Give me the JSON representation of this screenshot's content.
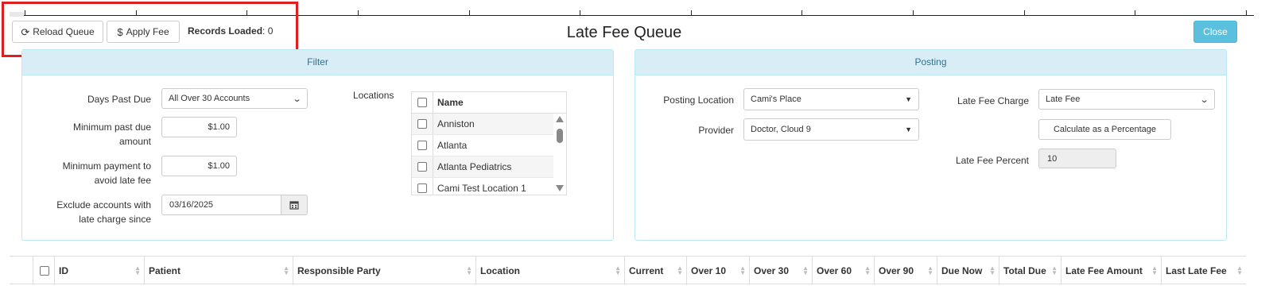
{
  "toolbar": {
    "reload_label": "Reload Queue",
    "apply_label": "Apply Fee",
    "records_label": "Records Loaded",
    "records_value": ": 0",
    "close_label": "Close",
    "reload_icon": "refresh-icon",
    "apply_icon": "dollar-icon"
  },
  "page_title": "Late Fee Queue",
  "filter": {
    "title": "Filter",
    "days_past_due_label": "Days Past Due",
    "days_past_due_value": "All Over 30 Accounts",
    "min_past_due_label_1": "Minimum past due",
    "min_past_due_label_2": "amount",
    "min_past_due_value": "$1.00",
    "min_payment_label_1": "Minimum payment to",
    "min_payment_label_2": "avoid late fee",
    "min_payment_value": "$1.00",
    "exclude_label_1": "Exclude accounts with",
    "exclude_label_2": "late charge since",
    "exclude_date": "03/16/2025",
    "locations_label": "Locations",
    "locations_header": "Name",
    "locations": [
      "Anniston",
      "Atlanta",
      "Atlanta Pediatrics",
      "Cami Test Location 1"
    ]
  },
  "posting": {
    "title": "Posting",
    "posting_location_label": "Posting Location",
    "posting_location_value": "Cami's Place",
    "provider_label": "Provider",
    "provider_value": "Doctor, Cloud 9",
    "late_fee_charge_label": "Late Fee Charge",
    "late_fee_charge_value": "Late Fee",
    "calc_percentage_label": "Calculate as a Percentage",
    "late_fee_percent_label": "Late Fee Percent",
    "late_fee_percent_value": "10"
  },
  "grid": {
    "columns": [
      "ID",
      "Patient",
      "Responsible Party",
      "Location",
      "Current",
      "Over 10",
      "Over 30",
      "Over 60",
      "Over 90",
      "Due Now",
      "Total Due",
      "Late Fee Amount",
      "Last Late Fee"
    ]
  },
  "colors": {
    "panel_header_bg": "#d9edf7",
    "panel_header_text": "#31708f",
    "close_button": "#5bc0de",
    "highlight_box": "#e02020"
  }
}
